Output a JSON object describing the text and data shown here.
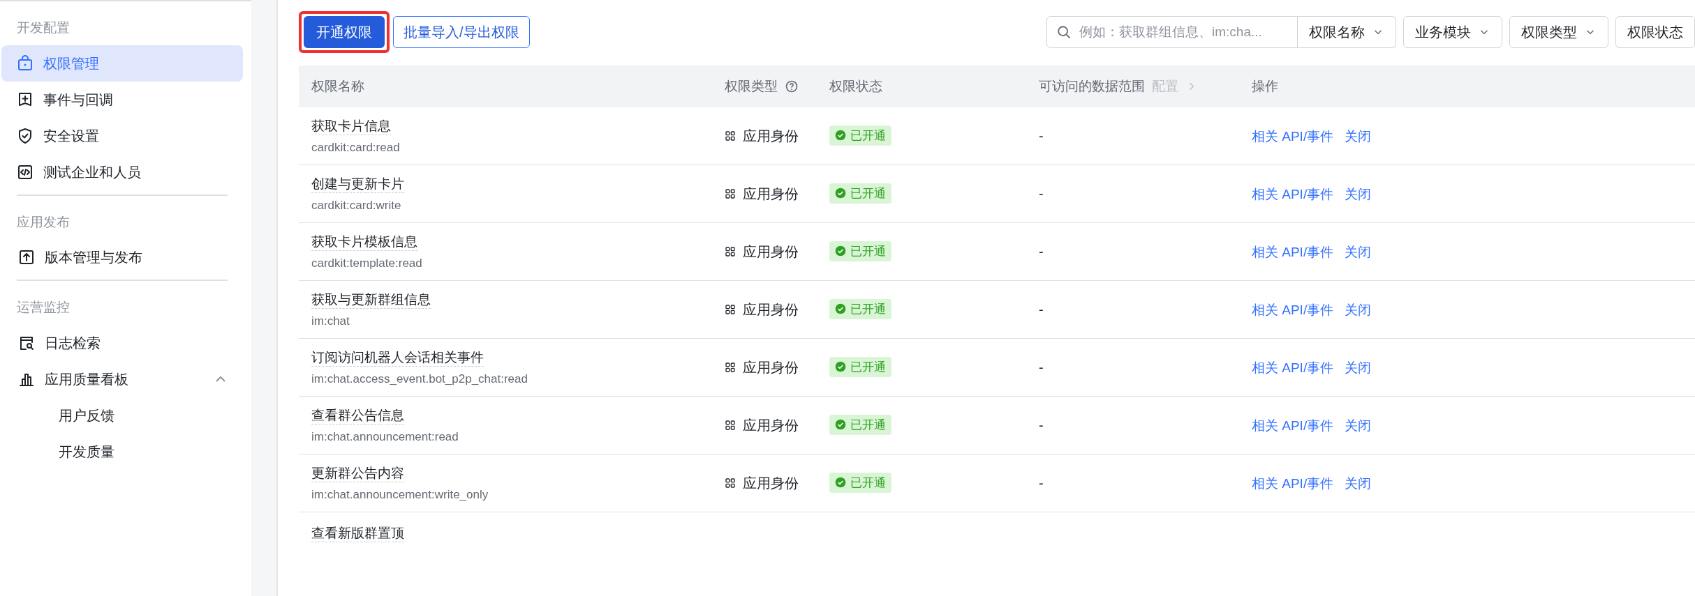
{
  "sidebar": {
    "sections": [
      {
        "title": "开发配置",
        "items": [
          {
            "label": "权限管理",
            "selected": true
          },
          {
            "label": "事件与回调",
            "selected": false
          },
          {
            "label": "安全设置",
            "selected": false
          },
          {
            "label": "测试企业和人员",
            "selected": false
          }
        ]
      },
      {
        "title": "应用发布",
        "items": [
          {
            "label": "版本管理与发布",
            "selected": false
          }
        ]
      },
      {
        "title": "运营监控",
        "items": [
          {
            "label": "日志检索",
            "selected": false
          },
          {
            "label": "应用质量看板",
            "selected": false,
            "expanded": true,
            "children": [
              {
                "label": "用户反馈",
                "selected": false
              },
              {
                "label": "开发质量",
                "selected": false
              }
            ]
          }
        ]
      }
    ]
  },
  "toolbar": {
    "primary_button": {
      "label": "开通权限",
      "highlighted": true
    },
    "secondary_button": {
      "label": "批量导入/导出权限"
    },
    "search": {
      "placeholder": "例如：获取群组信息、im:cha..."
    },
    "filters": [
      "权限名称",
      "业务模块",
      "权限类型",
      "权限状态"
    ]
  },
  "table": {
    "columns": [
      {
        "label": "权限名称"
      },
      {
        "label": "权限类型",
        "help": true
      },
      {
        "label": "权限状态"
      },
      {
        "label": "可访问的数据范围",
        "link": "配置"
      },
      {
        "label": "操作"
      }
    ],
    "rows": [
      {
        "name": "获取卡片信息",
        "code": "cardkit:card:read",
        "type": "应用身份",
        "status": "已开通",
        "range": "-",
        "actions": [
          "相关 API/事件",
          "关闭"
        ]
      },
      {
        "name": "创建与更新卡片",
        "code": "cardkit:card:write",
        "type": "应用身份",
        "status": "已开通",
        "range": "-",
        "actions": [
          "相关 API/事件",
          "关闭"
        ]
      },
      {
        "name": "获取卡片模板信息",
        "code": "cardkit:template:read",
        "type": "应用身份",
        "status": "已开通",
        "range": "-",
        "actions": [
          "相关 API/事件",
          "关闭"
        ]
      },
      {
        "name": "获取与更新群组信息",
        "code": "im:chat",
        "type": "应用身份",
        "status": "已开通",
        "range": "-",
        "actions": [
          "相关 API/事件",
          "关闭"
        ]
      },
      {
        "name": "订阅访问机器人会话相关事件",
        "code": "im:chat.access_event.bot_p2p_chat:read",
        "type": "应用身份",
        "status": "已开通",
        "range": "-",
        "actions": [
          "相关 API/事件",
          "关闭"
        ]
      },
      {
        "name": "查看群公告信息",
        "code": "im:chat.announcement:read",
        "type": "应用身份",
        "status": "已开通",
        "range": "-",
        "actions": [
          "相关 API/事件",
          "关闭"
        ]
      },
      {
        "name": "更新群公告内容",
        "code": "im:chat.announcement:write_only",
        "type": "应用身份",
        "status": "已开通",
        "range": "-",
        "actions": [
          "相关 API/事件",
          "关闭"
        ]
      },
      {
        "name": "查看新版群置顶"
      }
    ]
  }
}
